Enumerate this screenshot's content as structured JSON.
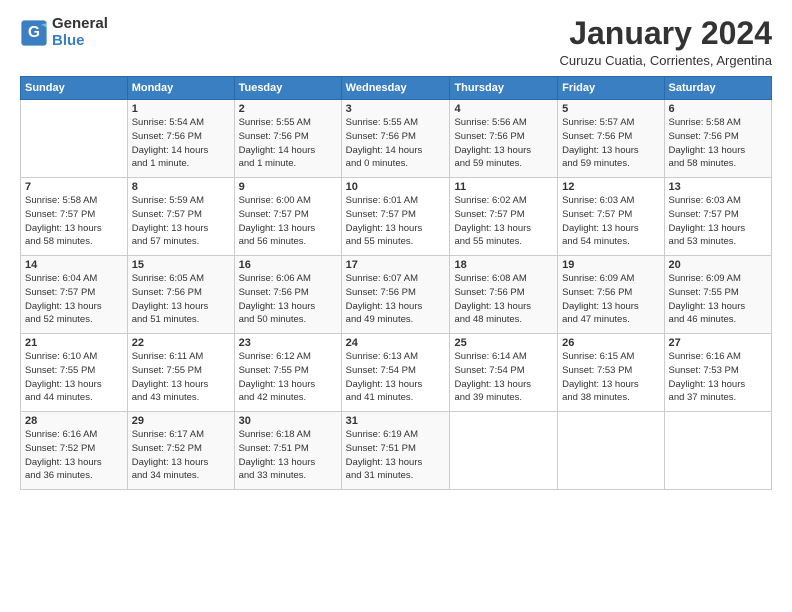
{
  "logo": {
    "general": "General",
    "blue": "Blue"
  },
  "title": "January 2024",
  "subtitle": "Curuzu Cuatia, Corrientes, Argentina",
  "days_header": [
    "Sunday",
    "Monday",
    "Tuesday",
    "Wednesday",
    "Thursday",
    "Friday",
    "Saturday"
  ],
  "weeks": [
    [
      {
        "day": "",
        "info": ""
      },
      {
        "day": "1",
        "info": "Sunrise: 5:54 AM\nSunset: 7:56 PM\nDaylight: 14 hours\nand 1 minute."
      },
      {
        "day": "2",
        "info": "Sunrise: 5:55 AM\nSunset: 7:56 PM\nDaylight: 14 hours\nand 1 minute."
      },
      {
        "day": "3",
        "info": "Sunrise: 5:55 AM\nSunset: 7:56 PM\nDaylight: 14 hours\nand 0 minutes."
      },
      {
        "day": "4",
        "info": "Sunrise: 5:56 AM\nSunset: 7:56 PM\nDaylight: 13 hours\nand 59 minutes."
      },
      {
        "day": "5",
        "info": "Sunrise: 5:57 AM\nSunset: 7:56 PM\nDaylight: 13 hours\nand 59 minutes."
      },
      {
        "day": "6",
        "info": "Sunrise: 5:58 AM\nSunset: 7:56 PM\nDaylight: 13 hours\nand 58 minutes."
      }
    ],
    [
      {
        "day": "7",
        "info": "Sunrise: 5:58 AM\nSunset: 7:57 PM\nDaylight: 13 hours\nand 58 minutes."
      },
      {
        "day": "8",
        "info": "Sunrise: 5:59 AM\nSunset: 7:57 PM\nDaylight: 13 hours\nand 57 minutes."
      },
      {
        "day": "9",
        "info": "Sunrise: 6:00 AM\nSunset: 7:57 PM\nDaylight: 13 hours\nand 56 minutes."
      },
      {
        "day": "10",
        "info": "Sunrise: 6:01 AM\nSunset: 7:57 PM\nDaylight: 13 hours\nand 55 minutes."
      },
      {
        "day": "11",
        "info": "Sunrise: 6:02 AM\nSunset: 7:57 PM\nDaylight: 13 hours\nand 55 minutes."
      },
      {
        "day": "12",
        "info": "Sunrise: 6:03 AM\nSunset: 7:57 PM\nDaylight: 13 hours\nand 54 minutes."
      },
      {
        "day": "13",
        "info": "Sunrise: 6:03 AM\nSunset: 7:57 PM\nDaylight: 13 hours\nand 53 minutes."
      }
    ],
    [
      {
        "day": "14",
        "info": "Sunrise: 6:04 AM\nSunset: 7:57 PM\nDaylight: 13 hours\nand 52 minutes."
      },
      {
        "day": "15",
        "info": "Sunrise: 6:05 AM\nSunset: 7:56 PM\nDaylight: 13 hours\nand 51 minutes."
      },
      {
        "day": "16",
        "info": "Sunrise: 6:06 AM\nSunset: 7:56 PM\nDaylight: 13 hours\nand 50 minutes."
      },
      {
        "day": "17",
        "info": "Sunrise: 6:07 AM\nSunset: 7:56 PM\nDaylight: 13 hours\nand 49 minutes."
      },
      {
        "day": "18",
        "info": "Sunrise: 6:08 AM\nSunset: 7:56 PM\nDaylight: 13 hours\nand 48 minutes."
      },
      {
        "day": "19",
        "info": "Sunrise: 6:09 AM\nSunset: 7:56 PM\nDaylight: 13 hours\nand 47 minutes."
      },
      {
        "day": "20",
        "info": "Sunrise: 6:09 AM\nSunset: 7:55 PM\nDaylight: 13 hours\nand 46 minutes."
      }
    ],
    [
      {
        "day": "21",
        "info": "Sunrise: 6:10 AM\nSunset: 7:55 PM\nDaylight: 13 hours\nand 44 minutes."
      },
      {
        "day": "22",
        "info": "Sunrise: 6:11 AM\nSunset: 7:55 PM\nDaylight: 13 hours\nand 43 minutes."
      },
      {
        "day": "23",
        "info": "Sunrise: 6:12 AM\nSunset: 7:55 PM\nDaylight: 13 hours\nand 42 minutes."
      },
      {
        "day": "24",
        "info": "Sunrise: 6:13 AM\nSunset: 7:54 PM\nDaylight: 13 hours\nand 41 minutes."
      },
      {
        "day": "25",
        "info": "Sunrise: 6:14 AM\nSunset: 7:54 PM\nDaylight: 13 hours\nand 39 minutes."
      },
      {
        "day": "26",
        "info": "Sunrise: 6:15 AM\nSunset: 7:53 PM\nDaylight: 13 hours\nand 38 minutes."
      },
      {
        "day": "27",
        "info": "Sunrise: 6:16 AM\nSunset: 7:53 PM\nDaylight: 13 hours\nand 37 minutes."
      }
    ],
    [
      {
        "day": "28",
        "info": "Sunrise: 6:16 AM\nSunset: 7:52 PM\nDaylight: 13 hours\nand 36 minutes."
      },
      {
        "day": "29",
        "info": "Sunrise: 6:17 AM\nSunset: 7:52 PM\nDaylight: 13 hours\nand 34 minutes."
      },
      {
        "day": "30",
        "info": "Sunrise: 6:18 AM\nSunset: 7:51 PM\nDaylight: 13 hours\nand 33 minutes."
      },
      {
        "day": "31",
        "info": "Sunrise: 6:19 AM\nSunset: 7:51 PM\nDaylight: 13 hours\nand 31 minutes."
      },
      {
        "day": "",
        "info": ""
      },
      {
        "day": "",
        "info": ""
      },
      {
        "day": "",
        "info": ""
      }
    ]
  ]
}
